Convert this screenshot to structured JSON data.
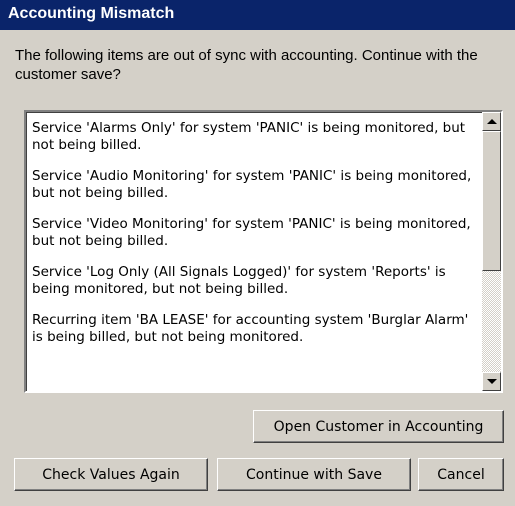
{
  "window": {
    "title": "Accounting Mismatch"
  },
  "prompt": "The following items are out of sync with accounting.  Continue with the customer save?",
  "items": [
    "Service 'Alarms Only' for system 'PANIC' is being monitored, but not being billed.",
    "Service 'Audio Monitoring' for system 'PANIC' is being monitored, but not being billed.",
    "Service 'Video Monitoring' for system 'PANIC' is being monitored, but not being billed.",
    "Service 'Log Only (All Signals Logged)' for system 'Reports' is being monitored, but not being billed.",
    "Recurring item 'BA LEASE' for accounting system 'Burglar Alarm' is being billed, but not being monitored."
  ],
  "buttons": {
    "open_accounting": "Open Customer in Accounting",
    "check_values": "Check Values Again",
    "continue_save": "Continue with Save",
    "cancel": "Cancel"
  },
  "icons": {
    "scroll_up": "up-arrow-icon",
    "scroll_down": "down-arrow-icon"
  },
  "colors": {
    "titlebar": "#0a246a",
    "dialog_bg": "#d4d0c8"
  }
}
